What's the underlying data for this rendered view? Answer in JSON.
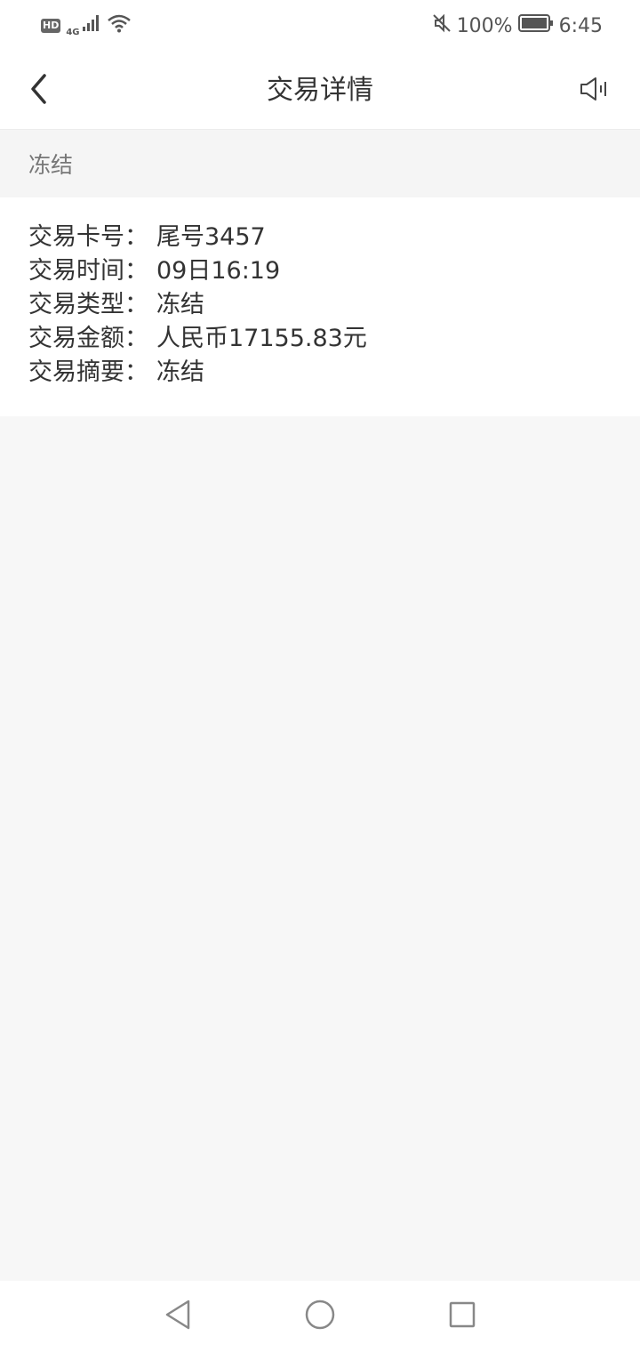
{
  "status_bar": {
    "hd_label": "HD",
    "network_label": "4G",
    "battery": "100%",
    "time": "6:45"
  },
  "header": {
    "title": "交易详情"
  },
  "section": {
    "title": "冻结"
  },
  "details": [
    {
      "label": "交易卡号：",
      "value": "尾号3457"
    },
    {
      "label": "交易时间：",
      "value": "09日16:19"
    },
    {
      "label": "交易类型：",
      "value": "冻结"
    },
    {
      "label": "交易金额：",
      "value": "人民币17155.83元"
    },
    {
      "label": "交易摘要：",
      "value": "冻结"
    }
  ],
  "icons": {
    "back": "chevron-left-icon",
    "speaker": "speaker-icon",
    "nav_back": "triangle-back-icon",
    "nav_home": "circle-home-icon",
    "nav_recents": "square-recents-icon"
  },
  "colors": {
    "background": "#f7f7f7",
    "card": "#ffffff",
    "text_primary": "#333333",
    "text_secondary": "#777777"
  }
}
